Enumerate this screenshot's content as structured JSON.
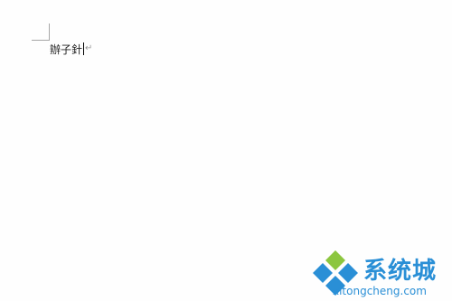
{
  "document": {
    "text": "辦子針",
    "paragraph_mark": "↵"
  },
  "watermark": {
    "title": "系统城",
    "url": "xitongcheng.com",
    "colors": {
      "blue": "#2a8fd6",
      "green": "#8cc63f"
    }
  }
}
